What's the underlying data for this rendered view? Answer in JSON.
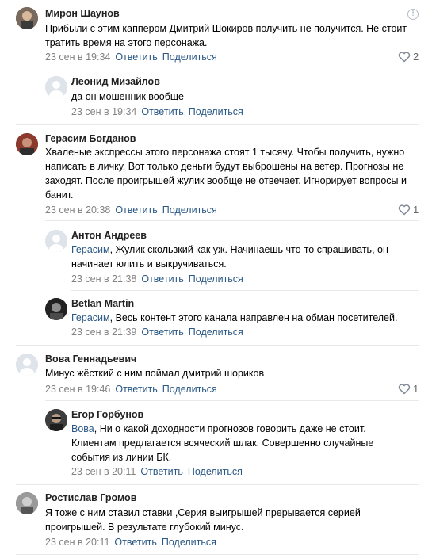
{
  "actions": {
    "reply": "Ответить",
    "share": "Поделиться"
  },
  "comments": [
    {
      "author": "Мирон Шаунов",
      "text": "Прибыли с этим каппером Дмитрий Шокиров получить не получится. Не стоит тратить время на этого персонажа.",
      "time": "23 сен в 19:34",
      "likes": "2",
      "report_icon": "!"
    },
    {
      "author": "Леонид Мизайлов",
      "text": "да он мошенник вообще",
      "time": "23 сен в 19:34"
    },
    {
      "author": "Герасим Богданов",
      "text": "Хваленые экспрессы этого персонажа стоят 1 тысячу. Чтобы получить, нужно написать в личку. Вот только деньги будут выброшены на ветер. Прогнозы не заходят. После проигрышей жулик вообще не отвечает. Игнорирует вопросы и банит.",
      "time": "23 сен в 20:38",
      "likes": "1"
    },
    {
      "author": "Антон Андреев",
      "mention": "Герасим",
      "text": ", Жулик скользкий как уж. Начинаешь что-то спрашивать, он начинает юлить и выкручиваться.",
      "time": "23 сен в 21:38"
    },
    {
      "author": "Betlan Martin",
      "mention": "Герасим",
      "text": ", Весь контент этого канала направлен на обман посетителей.",
      "time": "23 сен в 21:39"
    },
    {
      "author": "Вова Геннадьевич",
      "text": "Минус жёсткий с ним поймал дмитрий шориков",
      "time": "23 сен в 19:46",
      "likes": "1"
    },
    {
      "author": "Егор Горбунов",
      "mention": "Вова",
      "text": ", Ни о какой доходности прогнозов говорить даже не стоит. Клиентам предлагается всяческий шлак. Совершенно случайные события из линии БК.",
      "time": "23 сен в 20:11"
    },
    {
      "author": "Ростислав Громов",
      "text": "Я тоже с ним ставил ставки ,Серия выигрышей прерывается серией проигрышей. В результате глубокий минус.",
      "time": "23 сен в 20:11"
    }
  ]
}
